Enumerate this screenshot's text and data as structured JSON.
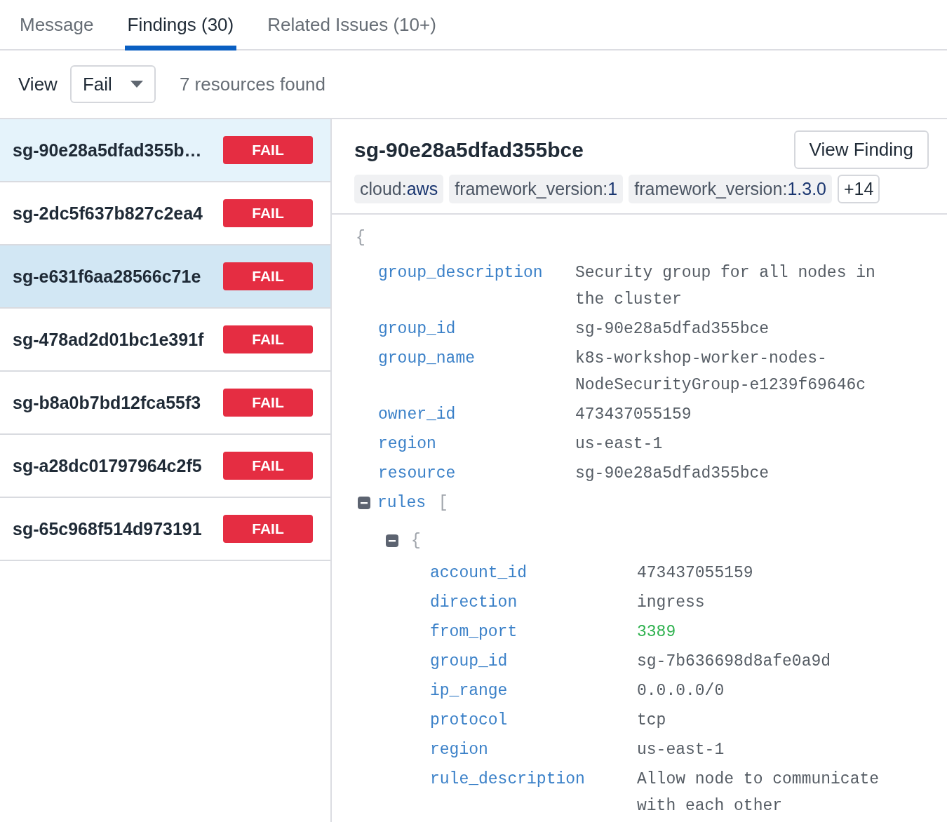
{
  "tabs": [
    {
      "label": "Message",
      "selected": false
    },
    {
      "label": "Findings (30)",
      "selected": true
    },
    {
      "label": "Related Issues (10+)",
      "selected": false
    }
  ],
  "toolbar": {
    "view_label": "View",
    "view_select": "Fail",
    "result_count": "7 resources found"
  },
  "resources": [
    {
      "name": "sg-90e28a5dfad355b…",
      "status": "FAIL",
      "selected": true,
      "hovered": false
    },
    {
      "name": "sg-2dc5f637b827c2ea4",
      "status": "FAIL",
      "selected": false,
      "hovered": false
    },
    {
      "name": "sg-e631f6aa28566c71e",
      "status": "FAIL",
      "selected": false,
      "hovered": true
    },
    {
      "name": "sg-478ad2d01bc1e391f",
      "status": "FAIL",
      "selected": false,
      "hovered": false
    },
    {
      "name": "sg-b8a0b7bd12fca55f3",
      "status": "FAIL",
      "selected": false,
      "hovered": false
    },
    {
      "name": "sg-a28dc01797964c2f5",
      "status": "FAIL",
      "selected": false,
      "hovered": false
    },
    {
      "name": "sg-65c968f514d973191",
      "status": "FAIL",
      "selected": false,
      "hovered": false
    }
  ],
  "detail": {
    "title": "sg-90e28a5dfad355bce",
    "button": "View Finding",
    "tags": [
      {
        "key": "cloud:",
        "value": "aws"
      },
      {
        "key": "framework_version:",
        "value": "1"
      },
      {
        "key": "framework_version:",
        "value": "1.3.0"
      }
    ],
    "more_tags": "+14",
    "json_view": {
      "brace": "{",
      "entries": [
        {
          "kind": "string",
          "key": "group_description",
          "value": "Security group for all nodes in the cluster"
        },
        {
          "kind": "string",
          "key": "group_id",
          "value": "sg-90e28a5dfad355bce"
        },
        {
          "kind": "string",
          "key": "group_name",
          "value": "k8s-workshop-worker-nodes-NodeSecurityGroup-e1239f69646c"
        },
        {
          "kind": "string",
          "key": "owner_id",
          "value": "473437055159"
        },
        {
          "kind": "string",
          "key": "region",
          "value": "us-east-1"
        },
        {
          "kind": "string",
          "key": "resource",
          "value": "sg-90e28a5dfad355bce"
        },
        {
          "kind": "array",
          "key": "rules",
          "bracket": "[",
          "expanded": true,
          "children": [
            {
              "kind": "object",
              "brace": "{",
              "expanded": true,
              "children": [
                {
                  "kind": "string",
                  "key": "account_id",
                  "value": "473437055159"
                },
                {
                  "kind": "string",
                  "key": "direction",
                  "value": "ingress"
                },
                {
                  "kind": "number",
                  "key": "from_port",
                  "value": "3389"
                },
                {
                  "kind": "string",
                  "key": "group_id",
                  "value": "sg-7b636698d8afe0a9d"
                },
                {
                  "kind": "string",
                  "key": "ip_range",
                  "value": "0.0.0.0/0"
                },
                {
                  "kind": "string",
                  "key": "protocol",
                  "value": "tcp"
                },
                {
                  "kind": "string",
                  "key": "region",
                  "value": "us-east-1"
                },
                {
                  "kind": "string",
                  "key": "rule_description",
                  "value": "Allow node to communicate with each other"
                }
              ]
            }
          ]
        }
      ]
    }
  }
}
